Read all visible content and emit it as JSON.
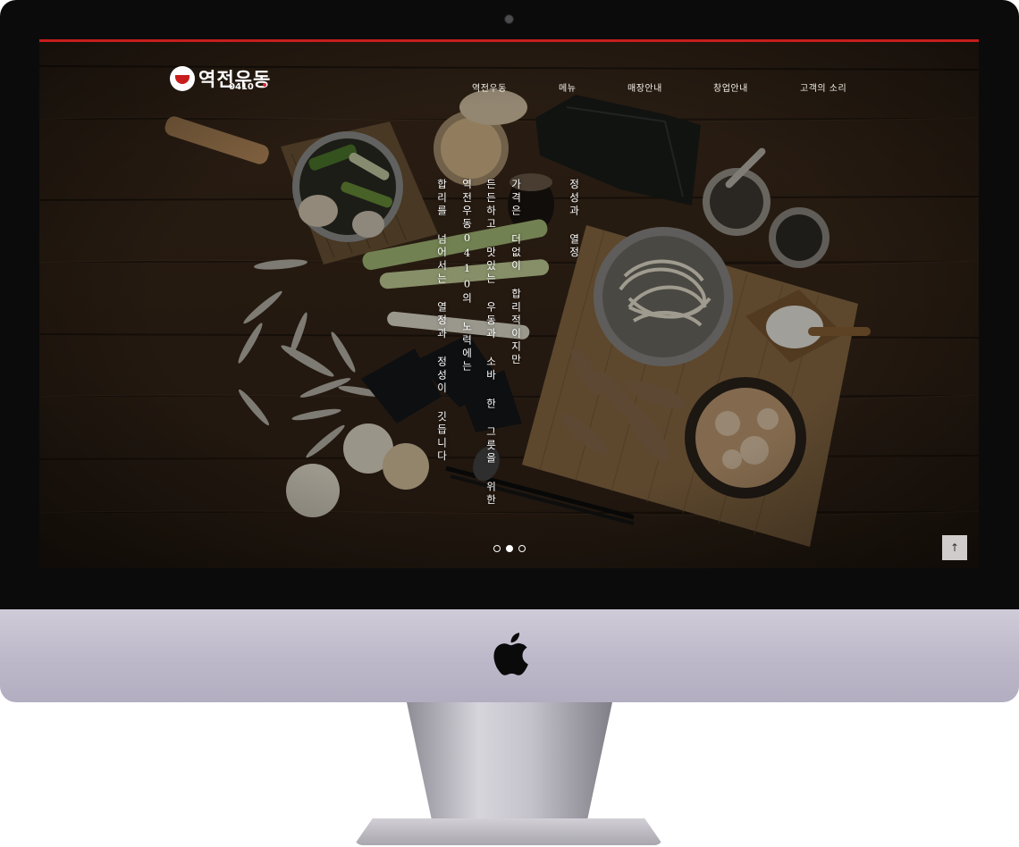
{
  "site": {
    "logo_text": "역전우동",
    "logo_sub": "0410",
    "nav": [
      {
        "label": "역전우동"
      },
      {
        "label": "메뉴"
      },
      {
        "label": "매장안내"
      },
      {
        "label": "창업안내"
      },
      {
        "label": "고객의 소리"
      }
    ],
    "slogan": {
      "title": "정성과 열정",
      "lines": [
        "가격은 더없이 합리적이지만",
        "든든하고 맛있는 우동과 소바 한 그릇을 위한",
        "역전우동0410의 노력에는",
        "합리를 넘어서는 열정과 정성이 깃듭니다"
      ]
    },
    "slider": {
      "count": 3,
      "active_index": 1
    },
    "scroll_top_glyph": "↑"
  },
  "colors": {
    "accent_red": "#c81d1d",
    "bezel": "#0b0b0c",
    "chin": "#bdb8c9",
    "wood": "#4a3420"
  },
  "icons": [
    "apple-logo-icon",
    "bowl-logo-icon",
    "arrow-up-icon"
  ]
}
